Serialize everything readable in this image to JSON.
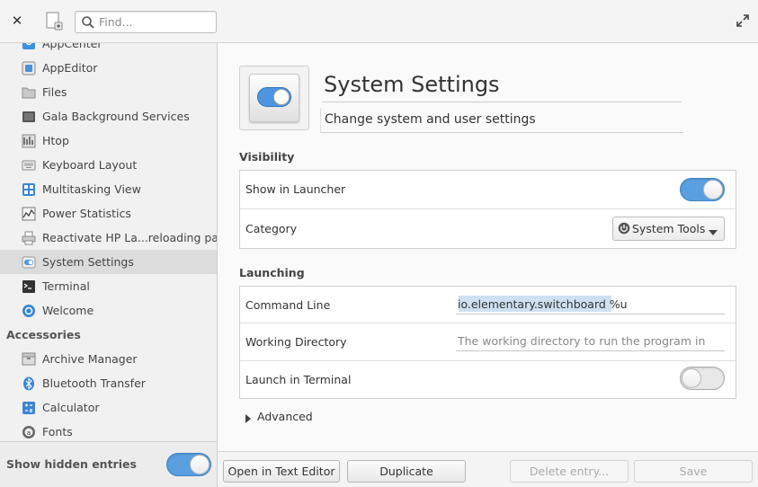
{
  "toolbar": {
    "close_icon": "close-icon",
    "new_icon": "new-document-icon",
    "search_placeholder": "Find...",
    "search_value": "",
    "maximize_icon": "maximize-icon"
  },
  "sidebar": {
    "items": [
      {
        "label": "AppCenter",
        "icon": "appcenter-icon"
      },
      {
        "label": "AppEditor",
        "icon": "appeditor-icon"
      },
      {
        "label": "Files",
        "icon": "folder-icon"
      },
      {
        "label": "Gala Background Services",
        "icon": "gala-icon"
      },
      {
        "label": "Htop",
        "icon": "htop-icon"
      },
      {
        "label": "Keyboard Layout",
        "icon": "keyboard-icon"
      },
      {
        "label": "Multitasking View",
        "icon": "multitasking-icon"
      },
      {
        "label": "Power Statistics",
        "icon": "power-statistics-icon"
      },
      {
        "label": "Reactivate HP La...reloading paper",
        "icon": "printer-icon"
      },
      {
        "label": "System Settings",
        "icon": "settings-icon",
        "selected": true
      },
      {
        "label": "Terminal",
        "icon": "terminal-icon"
      },
      {
        "label": "Welcome",
        "icon": "welcome-icon"
      }
    ],
    "group_header": "Accessories",
    "accessory_items": [
      {
        "label": "Archive Manager",
        "icon": "archive-icon"
      },
      {
        "label": "Bluetooth Transfer",
        "icon": "bluetooth-icon"
      },
      {
        "label": "Calculator",
        "icon": "calculator-icon"
      },
      {
        "label": "Fonts",
        "icon": "fonts-icon"
      }
    ],
    "footer_label": "Show hidden entries",
    "show_hidden_on": true
  },
  "main": {
    "app_name": "System Settings",
    "app_comment": "Change system and user settings",
    "visibility": {
      "title": "Visibility",
      "show_in_launcher_label": "Show in Launcher",
      "show_in_launcher_on": true,
      "category_label": "Category",
      "category_value": "System Tools"
    },
    "launching": {
      "title": "Launching",
      "command_label": "Command Line",
      "command_value": "io.elementary.switchboard %u",
      "workdir_label": "Working Directory",
      "workdir_placeholder": "The working directory to run the program in",
      "workdir_value": "",
      "terminal_label": "Launch in Terminal",
      "terminal_on": false
    },
    "advanced_label": "Advanced"
  },
  "actions": {
    "open_editor": "Open in Text Editor",
    "duplicate": "Duplicate",
    "delete": "Delete entry...",
    "save": "Save"
  },
  "colors": {
    "accent": "#5a9fe0",
    "selection": "#dcdcdc"
  }
}
